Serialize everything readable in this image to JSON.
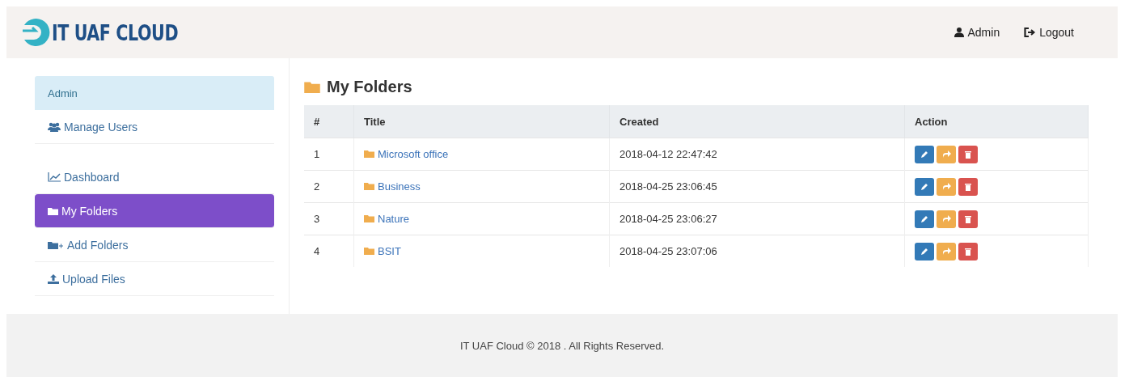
{
  "brand": {
    "name": "IT UAF CLOUD"
  },
  "navbar": {
    "items": [
      {
        "kind": "user",
        "label": "Admin"
      },
      {
        "kind": "logout",
        "label": "Logout"
      }
    ]
  },
  "sidebar": {
    "heading": "Admin",
    "groups": [
      [
        {
          "kind": "users",
          "label": "Manage Users",
          "selected": false
        }
      ],
      [
        {
          "kind": "dashboard",
          "label": "Dashboard",
          "selected": false
        },
        {
          "kind": "folder",
          "label": "My Folders",
          "selected": true
        },
        {
          "kind": "add-folder",
          "label": "Add Folders",
          "selected": false
        },
        {
          "kind": "upload",
          "label": "Upload Files",
          "selected": false
        }
      ]
    ]
  },
  "page": {
    "title": "My Folders"
  },
  "table": {
    "columns": [
      "#",
      "Title",
      "Created",
      "Action"
    ],
    "rows": [
      {
        "number": "1",
        "title": "Microsoft office",
        "created": "2018-04-12 22:47:42"
      },
      {
        "number": "2",
        "title": "Business",
        "created": "2018-04-25 23:06:45"
      },
      {
        "number": "3",
        "title": "Nature",
        "created": "2018-04-25 23:06:27"
      },
      {
        "number": "4",
        "title": "BSIT",
        "created": "2018-04-25 23:07:06"
      }
    ]
  },
  "footer": {
    "text": "IT UAF Cloud © 2018 . All Rights Reserved."
  }
}
